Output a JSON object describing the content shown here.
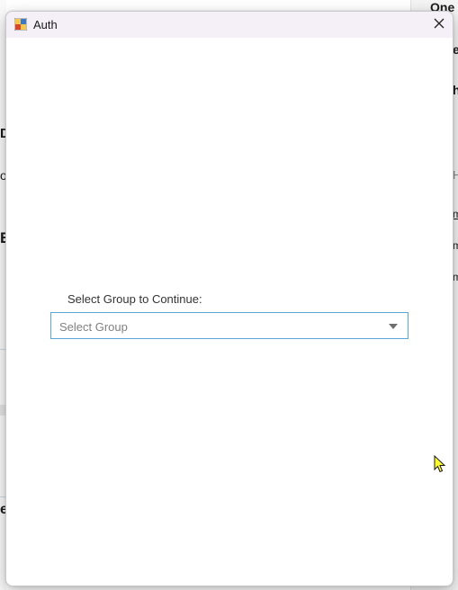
{
  "background": {
    "right_fragments": [
      "One",
      "e",
      "h",
      "H",
      "m",
      "m",
      "m"
    ],
    "left_fragments": [
      "D",
      "o",
      "E",
      "e"
    ]
  },
  "dialog": {
    "title": "Auth",
    "close_glyph": "✕",
    "select_label": "Select Group to Continue:",
    "select": {
      "value": "Select Group"
    }
  },
  "colors": {
    "titlebar": "#f5eff8",
    "select_border": "#5aa6d6",
    "cursor": "#ffff2e"
  },
  "icons": {
    "app": "app-icon",
    "close": "close-icon",
    "dropdown": "chevron-down-icon",
    "cursor": "mouse-cursor-icon"
  }
}
